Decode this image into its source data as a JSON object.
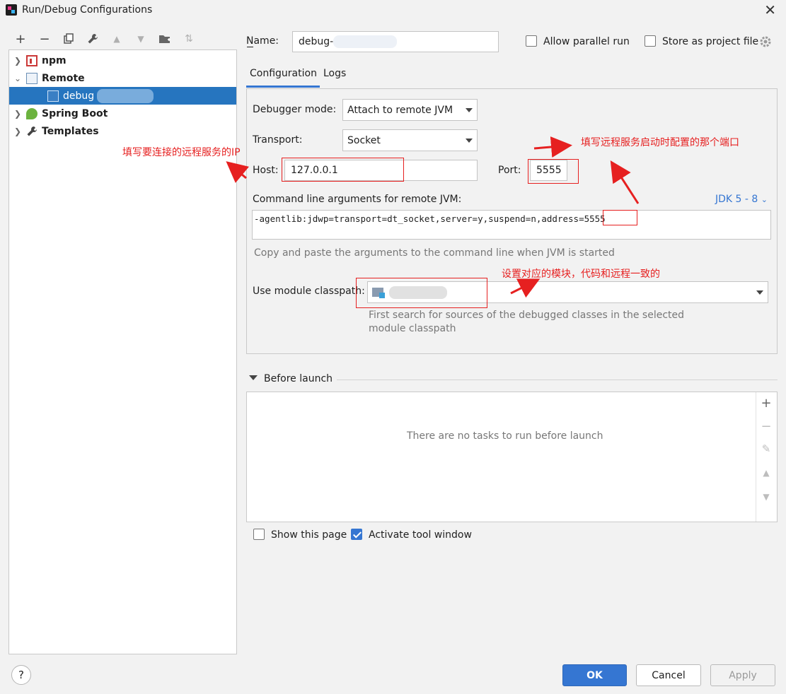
{
  "window": {
    "title": "Run/Debug Configurations"
  },
  "toolbar": {
    "add": "+",
    "remove": "−",
    "copy": "⧉",
    "edit": "🔧",
    "up": "▲",
    "down": "▼",
    "folder": "📁",
    "sort": "⇅"
  },
  "tree": {
    "items": [
      {
        "label": "npm",
        "icon": "npm-icon"
      },
      {
        "label": "Remote",
        "icon": "remote-icon"
      },
      {
        "label": "debug",
        "icon": "remote-debug-icon"
      },
      {
        "label": "Spring Boot",
        "icon": "spring-boot-icon"
      },
      {
        "label": "Templates",
        "icon": "wrench-icon"
      }
    ]
  },
  "form": {
    "name_label": "Name:",
    "name_value": "debug-",
    "allow_parallel_label": "Allow parallel run",
    "store_project_label": "Store as project file",
    "tabs": [
      "Configuration",
      "Logs"
    ],
    "debugger_mode_label": "Debugger mode:",
    "debugger_mode_value": "Attach to remote JVM",
    "transport_label": "Transport:",
    "transport_value": "Socket",
    "host_label": "Host:",
    "host_value": "127.0.0.1",
    "port_label": "Port:",
    "port_value": "5555",
    "cmd_label": "Command line arguments for remote JVM:",
    "jdk_label": "JDK 5 - 8",
    "cmd_value": "-agentlib:jdwp=transport=dt_socket,server=y,suspend=n,address=5555",
    "cmd_hint": "Copy and paste the arguments to the command line when JVM is started",
    "module_label": "Use module classpath:",
    "module_hint_1": "First search for sources of the debugged classes in the selected",
    "module_hint_2": "module classpath"
  },
  "annotations": {
    "host_note": "填写要连接的远程服务的IP",
    "port_note": "填写远程服务启动时配置的那个端口",
    "module_note": "设置对应的模块，代码和远程一致的"
  },
  "before_launch": {
    "label": "Before launch",
    "empty_text": "There are no tasks to run before launch",
    "show_page_label": "Show this page",
    "activate_tool_label": "Activate tool window",
    "activate_checked": true,
    "show_checked": false
  },
  "buttons": {
    "help": "?",
    "ok": "OK",
    "cancel": "Cancel",
    "apply": "Apply"
  },
  "colors": {
    "accent": "#3576d2",
    "selection": "#2675bf",
    "annotation": "#e62020"
  }
}
